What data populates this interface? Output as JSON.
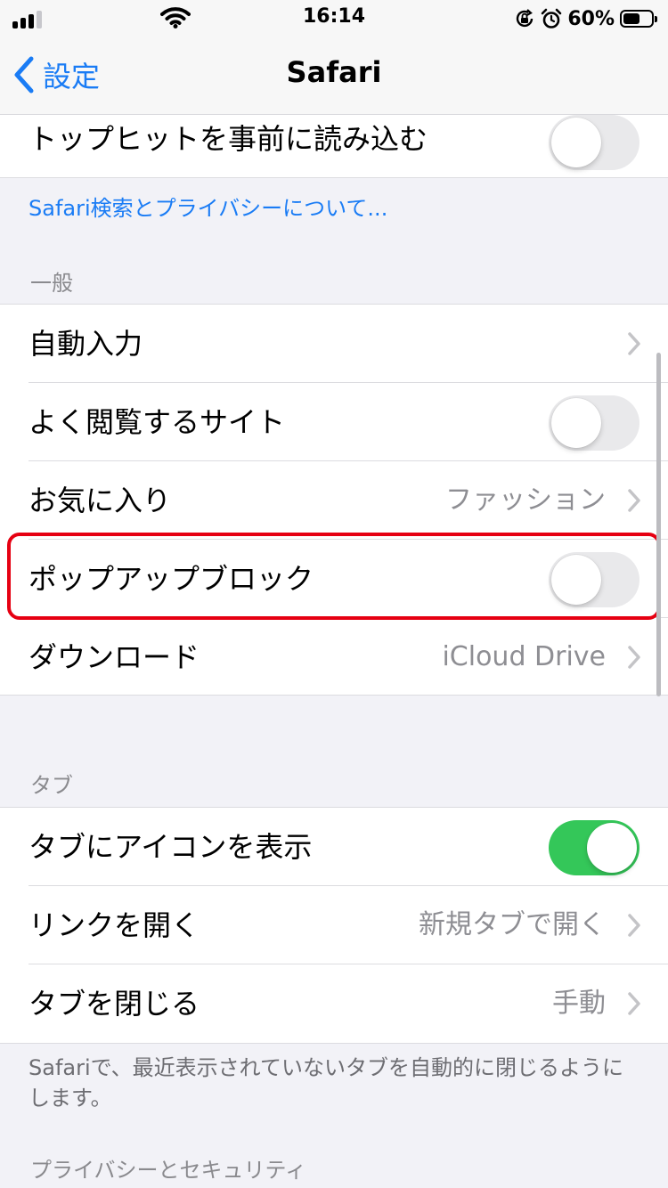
{
  "status_bar": {
    "time": "16:14",
    "battery_percent": "60%",
    "battery_level": 0.6,
    "signal_bars_filled": 3,
    "signal_bars_total": 4,
    "icons": [
      "signal-icon",
      "wifi-icon",
      "orientation-lock-icon",
      "alarm-icon",
      "battery-icon"
    ]
  },
  "nav": {
    "back_label": "設定",
    "title": "Safari"
  },
  "top_group": {
    "preload_label": "トップヒットを事前に読み込む",
    "preload_on": false
  },
  "privacy_link": "Safari検索とプライバシーについて...",
  "general": {
    "header": "一般",
    "rows": [
      {
        "label": "自動入力",
        "value": "",
        "type": "chevron"
      },
      {
        "label": "よく閲覧するサイト",
        "value": "",
        "type": "toggle",
        "on": false
      },
      {
        "label": "お気に入り",
        "value": "ファッション",
        "type": "chevron"
      },
      {
        "label": "ポップアップブロック",
        "value": "",
        "type": "toggle",
        "on": false
      },
      {
        "label": "ダウンロード",
        "value": "iCloud Drive",
        "type": "chevron"
      }
    ]
  },
  "tabs": {
    "header": "タブ",
    "rows": [
      {
        "label": "タブにアイコンを表示",
        "value": "",
        "type": "toggle",
        "on": true
      },
      {
        "label": "リンクを開く",
        "value": "新規タブで開く",
        "type": "chevron"
      },
      {
        "label": "タブを閉じる",
        "value": "手動",
        "type": "chevron"
      }
    ],
    "footer": "Safariで、最近表示されていないタブを自動的に閉じるようにします。"
  },
  "privacy_header": "プライバシーとセキュリティ",
  "colors": {
    "accent": "#1a7cf5",
    "toggle_on": "#34c759",
    "toggle_off": "#e9e9eb",
    "highlight": "#e60012",
    "background": "#f2f2f7"
  }
}
